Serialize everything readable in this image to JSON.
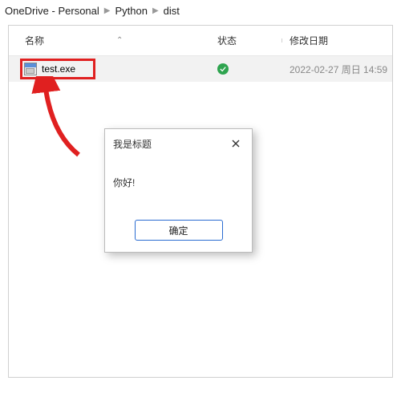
{
  "breadcrumb": {
    "items": [
      "OneDrive - Personal",
      "Python",
      "dist"
    ]
  },
  "columns": {
    "name": "名称",
    "status": "状态",
    "date": "修改日期"
  },
  "file": {
    "name": "test.exe",
    "date": "2022-02-27 周日 14:59"
  },
  "dialog": {
    "title": "我是标题",
    "body": "你好!",
    "ok": "确定"
  }
}
